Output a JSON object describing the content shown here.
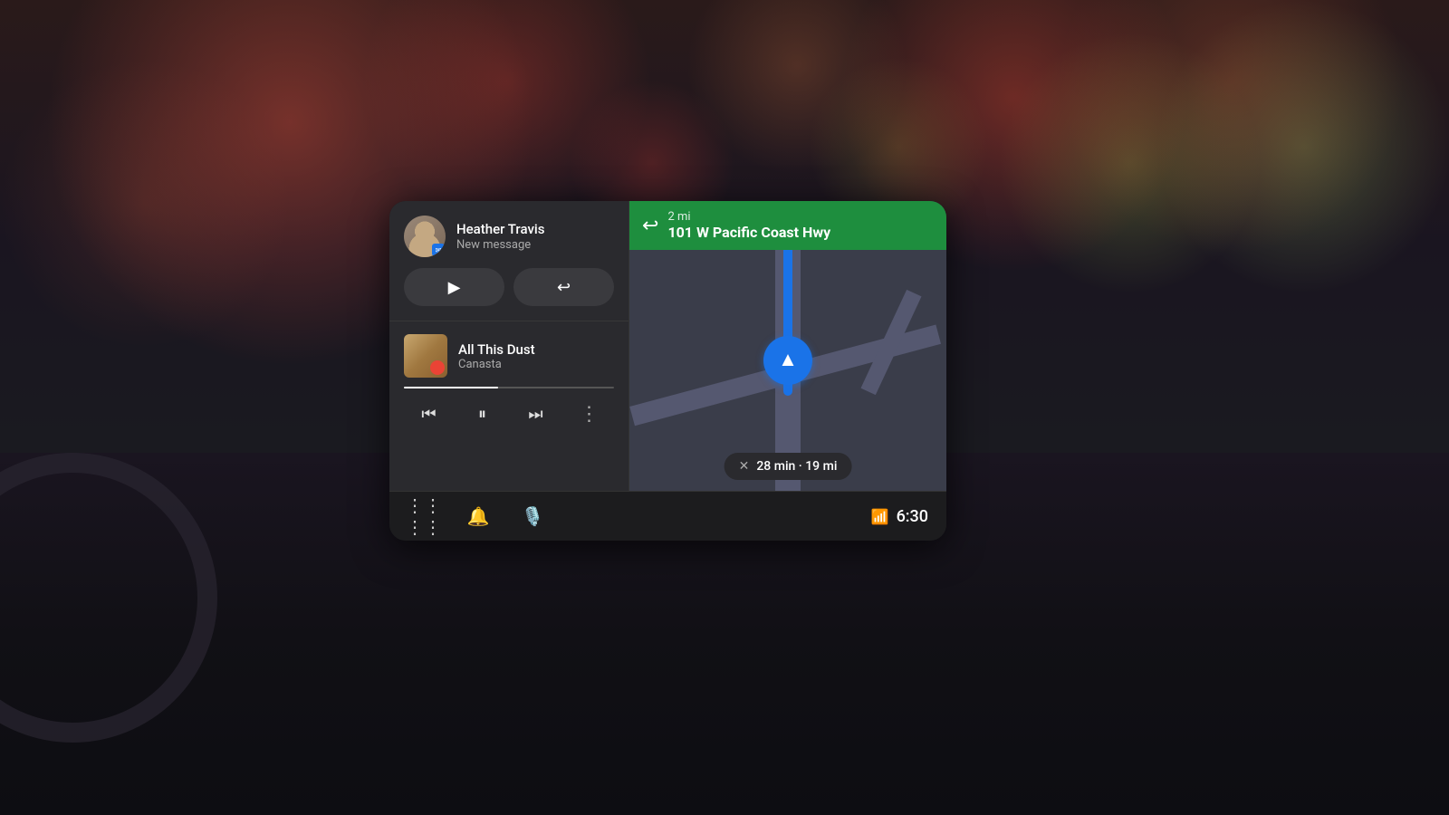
{
  "background": {
    "description": "Bokeh car dashboard night scene"
  },
  "display": {
    "message_card": {
      "sender": "Heather Travis",
      "subtitle": "New message",
      "play_label": "▶",
      "reply_label": "↩"
    },
    "music_card": {
      "track": "All This Dust",
      "artist": "Canasta",
      "progress_pct": 45
    },
    "music_controls": {
      "prev": "⏮",
      "pause": "⏸",
      "next": "⏭",
      "more": "⋮"
    },
    "navigation": {
      "distance": "2 mi",
      "street": "101 W Pacific Coast Hwy",
      "eta": "28 min · 19 mi"
    },
    "bottom_bar": {
      "apps_icon": "⊞",
      "bell_icon": "🔔",
      "mic_icon": "🎤",
      "signal_icon": "📶",
      "time": "6:30"
    }
  }
}
